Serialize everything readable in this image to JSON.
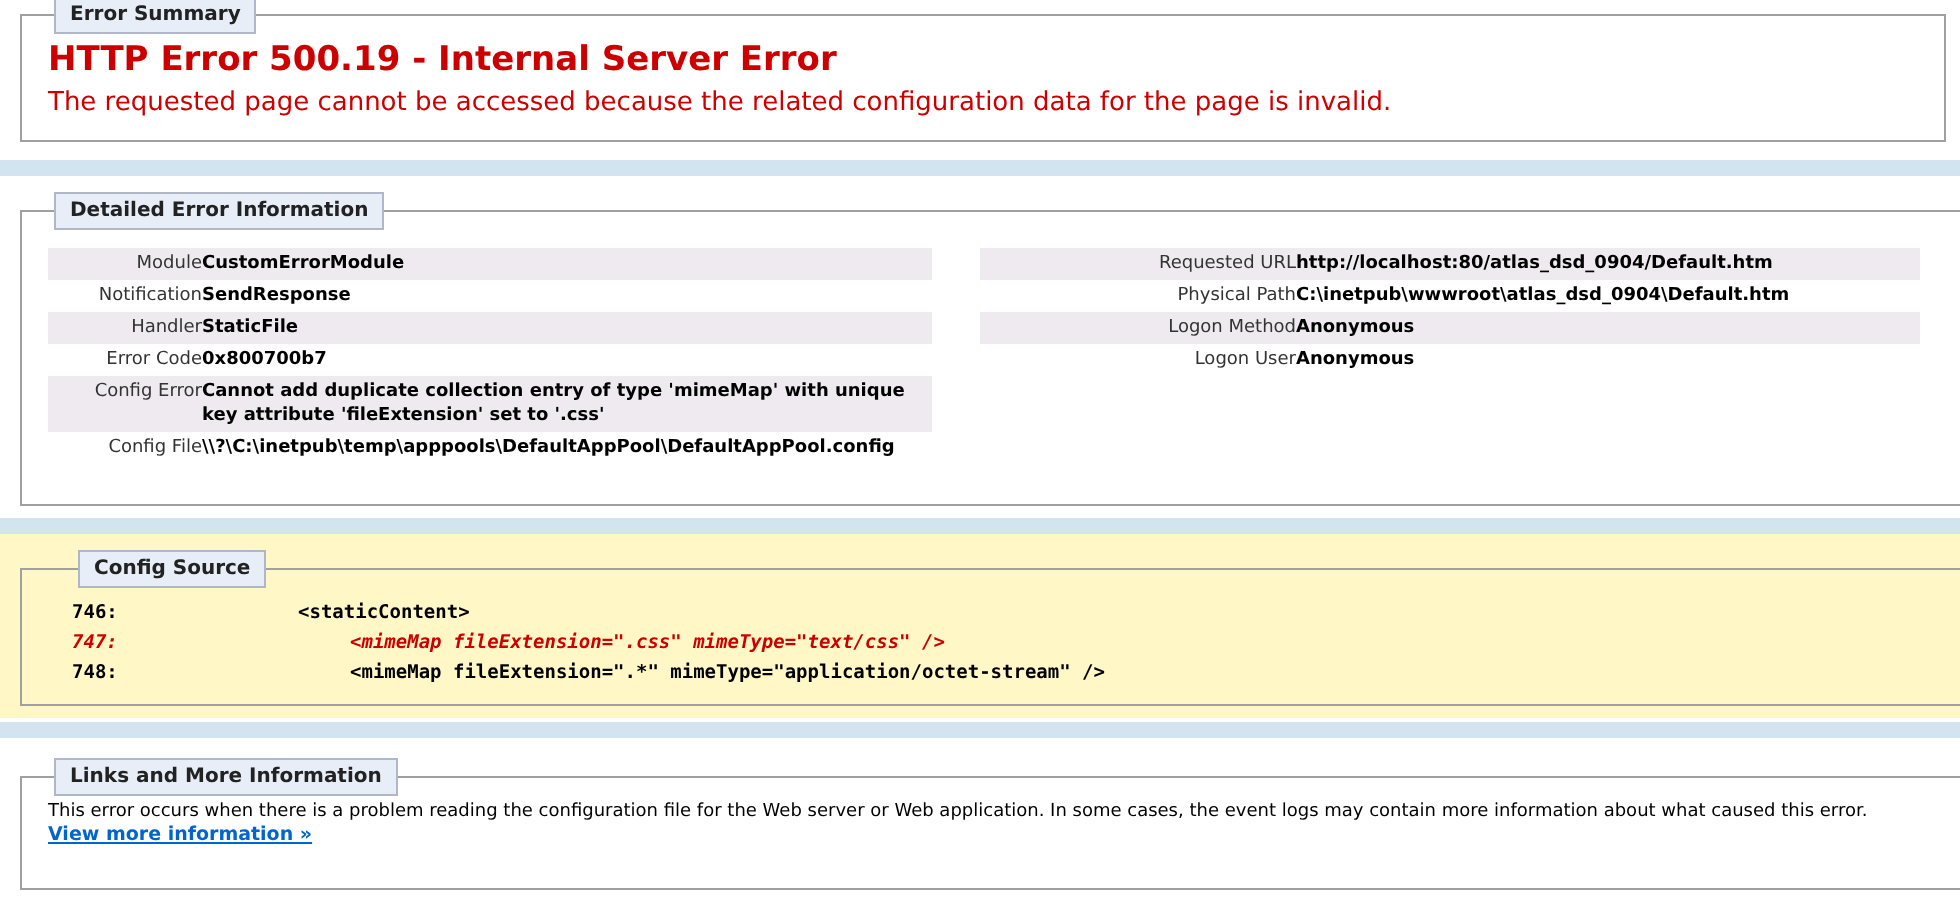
{
  "error_summary": {
    "legend": "Error Summary",
    "title": "HTTP Error 500.19 - Internal Server Error",
    "message": "The requested page cannot be accessed because the related configuration data for the page is invalid."
  },
  "detailed_error": {
    "legend": "Detailed Error Information",
    "left_rows": [
      {
        "label": "Module",
        "value": "CustomErrorModule"
      },
      {
        "label": "Notification",
        "value": "SendResponse"
      },
      {
        "label": "Handler",
        "value": "StaticFile"
      },
      {
        "label": "Error Code",
        "value": "0x800700b7"
      },
      {
        "label": "Config Error",
        "value": "Cannot add duplicate collection entry of type 'mimeMap' with unique key attribute 'fileExtension' set to '.css'"
      },
      {
        "label": "Config File",
        "value": "\\\\?\\C:\\inetpub\\temp\\apppools\\DefaultAppPool\\DefaultAppPool.config"
      }
    ],
    "right_rows": [
      {
        "label": "Requested URL",
        "value": "http://localhost:80/atlas_dsd_0904/Default.htm"
      },
      {
        "label": "Physical Path",
        "value": "C:\\inetpub\\wwwroot\\atlas_dsd_0904\\Default.htm"
      },
      {
        "label": "Logon Method",
        "value": "Anonymous"
      },
      {
        "label": "Logon User",
        "value": "Anonymous"
      }
    ]
  },
  "config_source": {
    "legend": "Config Source",
    "lines": [
      {
        "number": "746:",
        "code": "<staticContent>",
        "highlighted": false,
        "indent": false
      },
      {
        "number": "747:",
        "code": "<mimeMap fileExtension=\".css\" mimeType=\"text/css\" />",
        "highlighted": true,
        "indent": true
      },
      {
        "number": "748:",
        "code": "<mimeMap fileExtension=\".*\" mimeType=\"application/octet-stream\" />",
        "highlighted": false,
        "indent": true
      }
    ]
  },
  "links": {
    "legend": "Links and More Information",
    "text": "This error occurs when there is a problem reading the configuration file for the Web server or Web application. In some cases, the event logs may contain more information about what caused this error.",
    "link": "View more information »"
  }
}
